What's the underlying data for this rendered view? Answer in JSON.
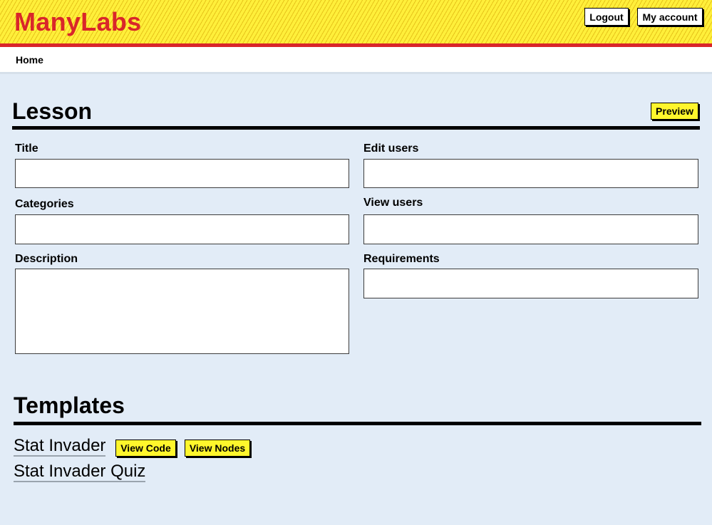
{
  "header": {
    "logo": "ManyLabs",
    "logout_label": "Logout",
    "account_label": "My account"
  },
  "nav": {
    "home_label": "Home"
  },
  "lesson": {
    "title": "Lesson",
    "preview_label": "Preview",
    "fields": {
      "title_label": "Title",
      "title_value": "",
      "categories_label": "Categories",
      "categories_value": "",
      "description_label": "Description",
      "description_value": "",
      "edit_users_label": "Edit users",
      "edit_users_value": "",
      "view_users_label": "View users",
      "view_users_value": "",
      "requirements_label": "Requirements",
      "requirements_value": ""
    }
  },
  "templates": {
    "title": "Templates",
    "items": [
      {
        "name": "Stat Invader",
        "view_code_label": "View Code",
        "view_nodes_label": "View Nodes"
      },
      {
        "name": "Stat Invader Quiz"
      }
    ]
  },
  "colors": {
    "header_bg": "#ffef3a",
    "brand_red": "#d9262a",
    "button_yellow": "#fff62c",
    "page_bg": "#e2ecf7"
  }
}
